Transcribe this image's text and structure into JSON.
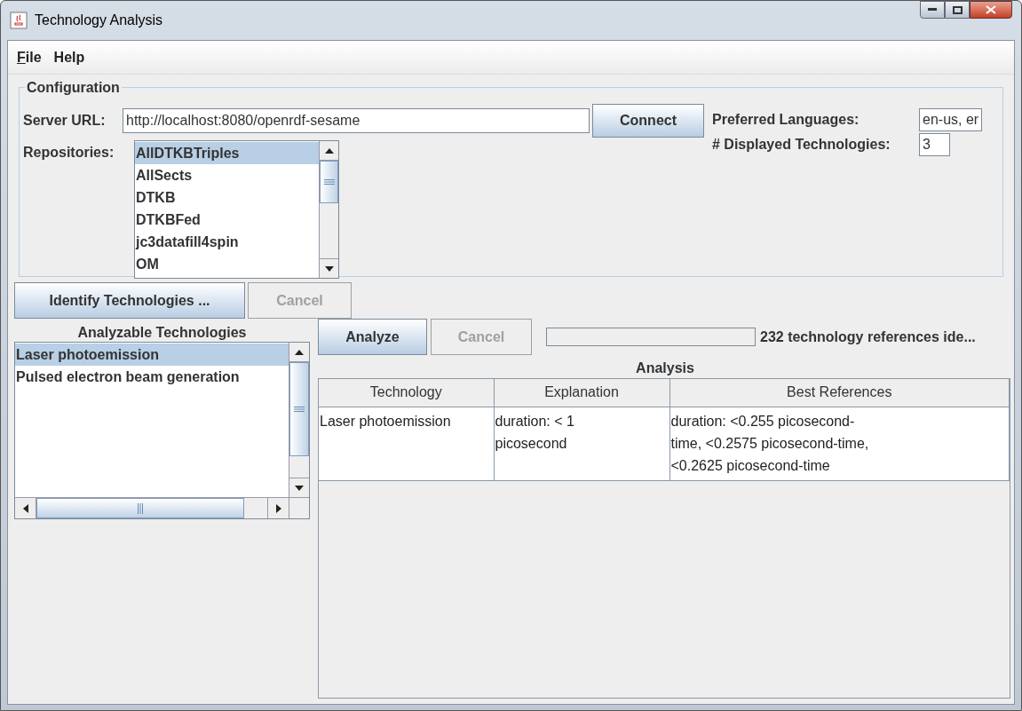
{
  "window": {
    "title": "Technology Analysis"
  },
  "menu": [
    {
      "label": "File",
      "underline_first": true
    },
    {
      "label": "Help",
      "underline_first": false
    }
  ],
  "configuration": {
    "title": "Configuration",
    "server_url": {
      "label": "Server URL:",
      "value": "http://localhost:8080/openrdf-sesame"
    },
    "connect_button": {
      "label": "Connect",
      "disabled": false
    },
    "preferred_languages": {
      "label": "Preferred Languages:",
      "value": "en-us, er"
    },
    "displayed_technologies": {
      "label": "# Displayed Technologies:",
      "value": "3"
    },
    "repositories": {
      "label": "Repositories:",
      "items": [
        {
          "label": "AllDTKBTriples",
          "selected": true
        },
        {
          "label": "AllSects",
          "selected": false
        },
        {
          "label": "DTKB",
          "selected": false
        },
        {
          "label": "DTKBFed",
          "selected": false
        },
        {
          "label": "jc3datafill4spin",
          "selected": false
        },
        {
          "label": "OM",
          "selected": false
        }
      ]
    }
  },
  "identify_buttons": [
    {
      "label": "Identify Technologies ...",
      "disabled": false
    },
    {
      "label": "Cancel",
      "disabled": true
    }
  ],
  "analyzable": {
    "title": "Analyzable Technologies",
    "items": [
      {
        "label": "Laser photoemission",
        "selected": true
      },
      {
        "label": "Pulsed electron beam generation",
        "selected": false
      }
    ]
  },
  "analyze_buttons": [
    {
      "label": "Analyze",
      "disabled": false
    },
    {
      "label": "Cancel",
      "disabled": true
    }
  ],
  "progress": {
    "level": 0
  },
  "status": "232 technology references ide...",
  "analysis": {
    "title": "Analysis",
    "columns": [
      "Technology",
      "Explanation",
      "Best References"
    ],
    "rows": [
      [
        "Laser photoemission",
        "duration: < 1 picosecond",
        "duration: <0.255 picosecond-time, <0.2575 picosecond-time, <0.2625 picosecond-time"
      ]
    ]
  }
}
